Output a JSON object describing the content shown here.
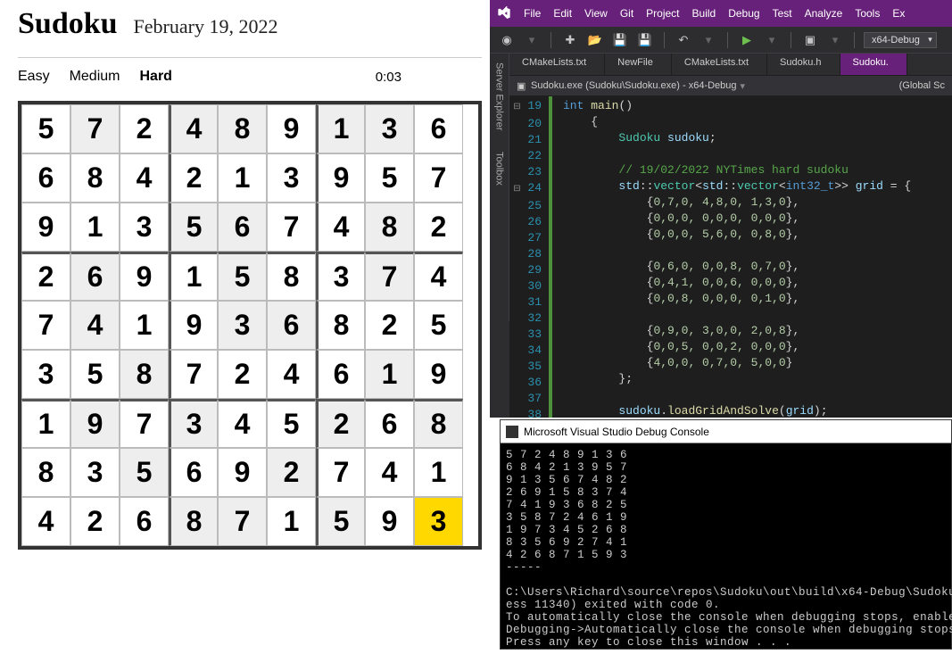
{
  "sudoku": {
    "title": "Sudoku",
    "date": "February 19, 2022",
    "difficulties": [
      "Easy",
      "Medium",
      "Hard"
    ],
    "active_difficulty": 2,
    "timer": "0:03",
    "grid": [
      [
        5,
        7,
        2,
        4,
        8,
        9,
        1,
        3,
        6
      ],
      [
        6,
        8,
        4,
        2,
        1,
        3,
        9,
        5,
        7
      ],
      [
        9,
        1,
        3,
        5,
        6,
        7,
        4,
        8,
        2
      ],
      [
        2,
        6,
        9,
        1,
        5,
        8,
        3,
        7,
        4
      ],
      [
        7,
        4,
        1,
        9,
        3,
        6,
        8,
        2,
        5
      ],
      [
        3,
        5,
        8,
        7,
        2,
        4,
        6,
        1,
        9
      ],
      [
        1,
        9,
        7,
        3,
        4,
        5,
        2,
        6,
        8
      ],
      [
        8,
        3,
        5,
        6,
        9,
        2,
        7,
        4,
        1
      ],
      [
        4,
        2,
        6,
        8,
        7,
        1,
        5,
        9,
        3
      ]
    ],
    "givens": [
      [
        0,
        1
      ],
      [
        0,
        3
      ],
      [
        0,
        4
      ],
      [
        0,
        6
      ],
      [
        0,
        7
      ],
      [
        2,
        3
      ],
      [
        2,
        4
      ],
      [
        2,
        7
      ],
      [
        3,
        1
      ],
      [
        3,
        4
      ],
      [
        3,
        7
      ],
      [
        4,
        1
      ],
      [
        4,
        4
      ],
      [
        4,
        5
      ],
      [
        5,
        2
      ],
      [
        5,
        7
      ],
      [
        6,
        1
      ],
      [
        6,
        3
      ],
      [
        6,
        6
      ],
      [
        6,
        8
      ],
      [
        7,
        2
      ],
      [
        7,
        5
      ],
      [
        8,
        3
      ],
      [
        8,
        4
      ],
      [
        8,
        6
      ]
    ],
    "highlight": [
      8,
      8
    ]
  },
  "vs": {
    "menu": [
      "File",
      "Edit",
      "View",
      "Git",
      "Project",
      "Build",
      "Debug",
      "Test",
      "Analyze",
      "Tools",
      "Ex"
    ],
    "config": "x64-Debug",
    "side_tabs": [
      "Server Explorer",
      "Toolbox"
    ],
    "file_tabs": [
      "CMakeLists.txt",
      "NewFile",
      "CMakeLists.txt",
      "Sudoku.h",
      "Sudoku."
    ],
    "active_file_tab": 4,
    "context_left": "Sudoku.exe (Sudoku\\Sudoku.exe) - x64-Debug",
    "context_right": "(Global Sc",
    "code_lines": [
      {
        "n": 19,
        "fold": "⊟",
        "html": "<span class='kw'>int</span> <span class='fn'>main</span><span class='punct'>()</span>"
      },
      {
        "n": 20,
        "fold": "",
        "html": "    <span class='punct'>{</span>"
      },
      {
        "n": 21,
        "fold": "",
        "html": "        <span class='type'>Sudoku</span> <span class='ident'>sudoku</span><span class='punct'>;</span>"
      },
      {
        "n": 22,
        "fold": "",
        "html": ""
      },
      {
        "n": 23,
        "fold": "",
        "html": "        <span class='cmt'>// 19/02/2022 NYTimes hard sudoku</span>"
      },
      {
        "n": 24,
        "fold": "⊟",
        "html": "        <span class='ident'>std</span><span class='punct'>::</span><span class='type'>vector</span><span class='punct'>&lt;</span><span class='ident'>std</span><span class='punct'>::</span><span class='type'>vector</span><span class='punct'>&lt;</span><span class='kw'>int32_t</span><span class='punct'>&gt;&gt;</span> <span class='ident'>grid</span> <span class='punct'>= {</span>"
      },
      {
        "n": 25,
        "fold": "",
        "html": "            <span class='punct'>{</span><span class='num'>0,7,0, 4,8,0, 1,3,0</span><span class='punct'>},</span>"
      },
      {
        "n": 26,
        "fold": "",
        "html": "            <span class='punct'>{</span><span class='num'>0,0,0, 0,0,0, 0,0,0</span><span class='punct'>},</span>"
      },
      {
        "n": 27,
        "fold": "",
        "html": "            <span class='punct'>{</span><span class='num'>0,0,0, 5,6,0, 0,8,0</span><span class='punct'>},</span>"
      },
      {
        "n": 28,
        "fold": "",
        "html": ""
      },
      {
        "n": 29,
        "fold": "",
        "html": "            <span class='punct'>{</span><span class='num'>0,6,0, 0,0,8, 0,7,0</span><span class='punct'>},</span>"
      },
      {
        "n": 30,
        "fold": "",
        "html": "            <span class='punct'>{</span><span class='num'>0,4,1, 0,0,6, 0,0,0</span><span class='punct'>},</span>"
      },
      {
        "n": 31,
        "fold": "",
        "html": "            <span class='punct'>{</span><span class='num'>0,0,8, 0,0,0, 0,1,0</span><span class='punct'>},</span>"
      },
      {
        "n": 32,
        "fold": "",
        "html": ""
      },
      {
        "n": 33,
        "fold": "",
        "html": "            <span class='punct'>{</span><span class='num'>0,9,0, 3,0,0, 2,0,8</span><span class='punct'>},</span>"
      },
      {
        "n": 34,
        "fold": "",
        "html": "            <span class='punct'>{</span><span class='num'>0,0,5, 0,0,2, 0,0,0</span><span class='punct'>},</span>"
      },
      {
        "n": 35,
        "fold": "",
        "html": "            <span class='punct'>{</span><span class='num'>4,0,0, 0,7,0, 5,0,0</span><span class='punct'>}</span>"
      },
      {
        "n": 36,
        "fold": "",
        "html": "        <span class='punct'>};</span>"
      },
      {
        "n": 37,
        "fold": "",
        "html": ""
      },
      {
        "n": 38,
        "fold": "",
        "html": "        <span class='ident'>sudoku</span><span class='punct'>.</span><span class='fn'>loadGridAndSolve</span><span class='punct'>(</span><span class='ident'>grid</span><span class='punct'>);</span>"
      }
    ]
  },
  "console": {
    "title": "Microsoft Visual Studio Debug Console",
    "lines": [
      "5 7 2 4 8 9 1 3 6",
      "6 8 4 2 1 3 9 5 7",
      "9 1 3 5 6 7 4 8 2",
      "2 6 9 1 5 8 3 7 4",
      "7 4 1 9 3 6 8 2 5",
      "3 5 8 7 2 4 6 1 9",
      "1 9 7 3 4 5 2 6 8",
      "8 3 5 6 9 2 7 4 1",
      "4 2 6 8 7 1 5 9 3",
      "-----",
      "",
      "C:\\Users\\Richard\\source\\repos\\Sudoku\\out\\build\\x64-Debug\\Sudoku",
      "ess 11340) exited with code 0.",
      "To automatically close the console when debugging stops, enable",
      "Debugging->Automatically close the console when debugging stops",
      "Press any key to close this window . . ."
    ]
  }
}
